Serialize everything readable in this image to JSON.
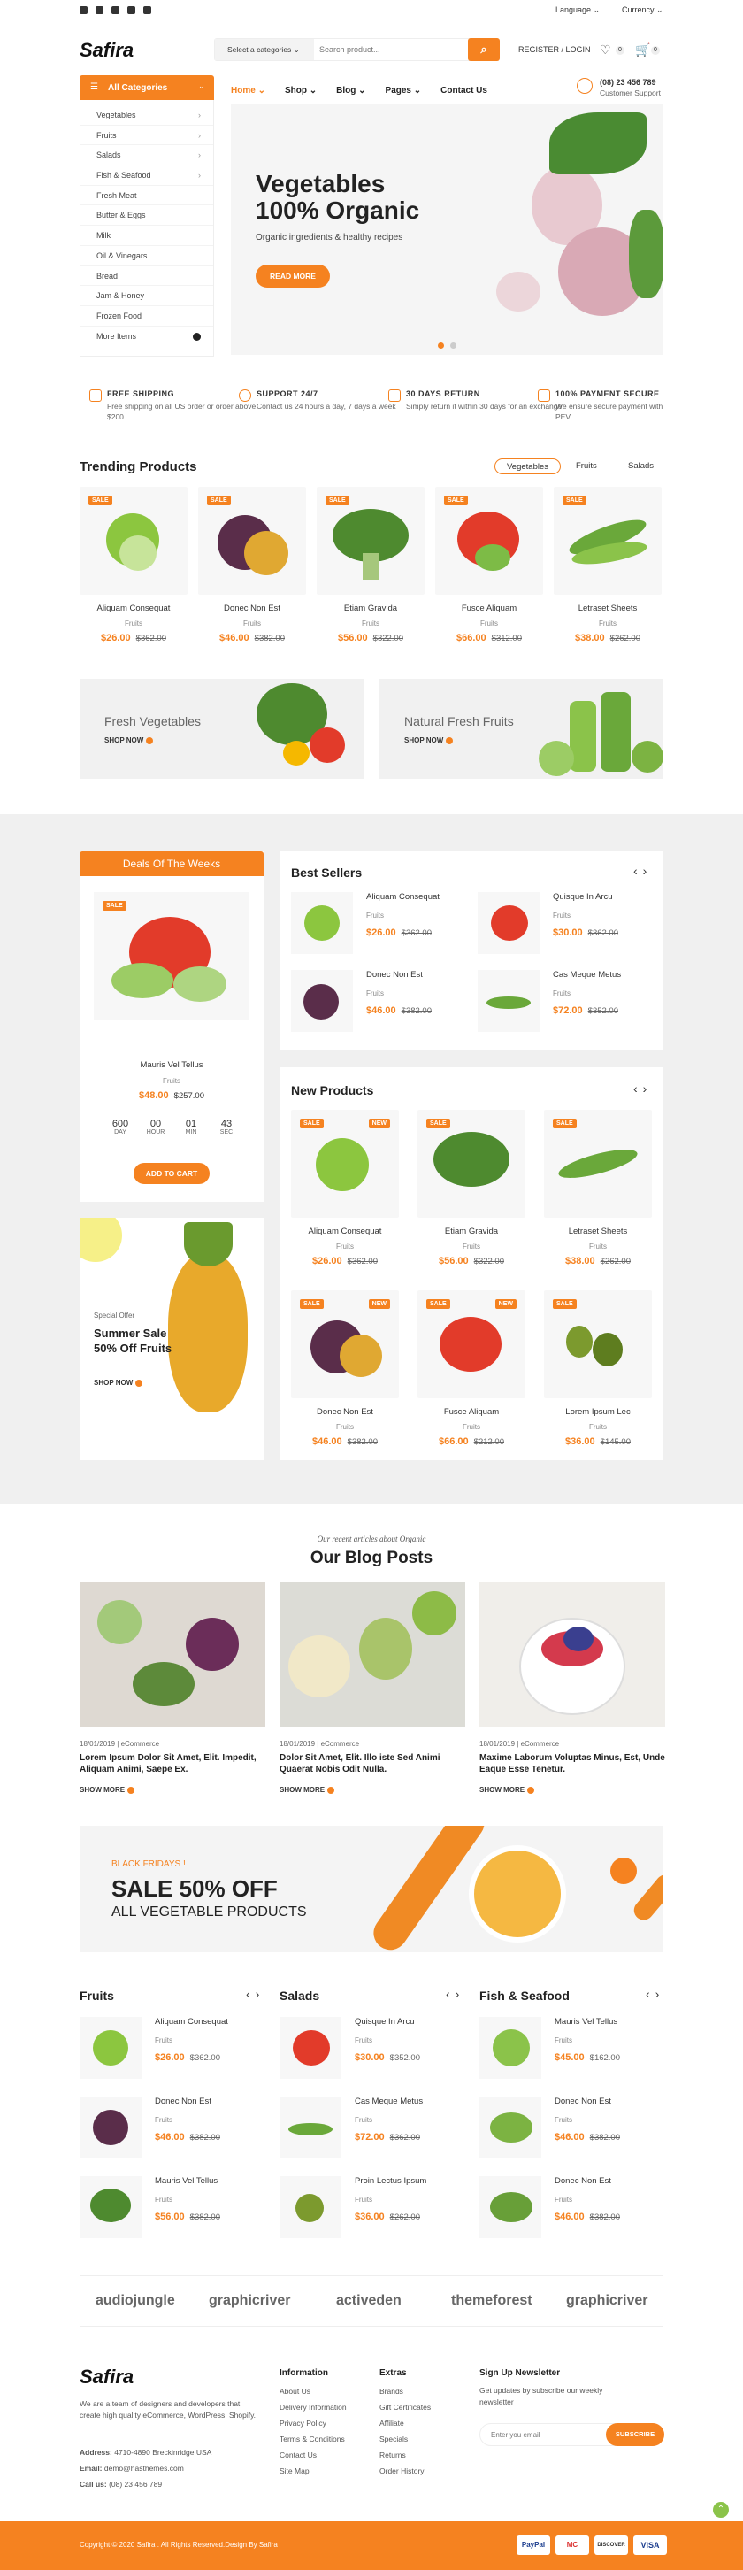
{
  "topbar": {
    "language": "Language",
    "currency": "Currency"
  },
  "header": {
    "logo": "Safira",
    "category_select": "Select a categories",
    "search_placeholder": "Search product...",
    "account": "REGISTER / LOGIN",
    "wishlist_count": "0",
    "cart_count": "0",
    "phone": "(08) 23 456 789",
    "support": "Customer Support"
  },
  "nav": {
    "items": [
      "Home",
      "Shop",
      "Blog",
      "Pages",
      "Contact Us"
    ]
  },
  "sidebar": {
    "title": "All Categories",
    "items": [
      "Vegetables",
      "Fruits",
      "Salads",
      "Fish & Seafood",
      "Fresh Meat",
      "Butter & Eggs",
      "Milk",
      "Oil & Vinegars",
      "Bread",
      "Jam & Honey",
      "Frozen Food",
      "More Items"
    ]
  },
  "hero": {
    "title1": "Vegetables",
    "title2": "100% Organic",
    "subtitle": "Organic ingredients & healthy recipes",
    "cta": "READ MORE"
  },
  "features": [
    {
      "title": "FREE SHIPPING",
      "desc": "Free shipping on all US order or order above $200"
    },
    {
      "title": "SUPPORT 24/7",
      "desc": "Contact us 24 hours a day, 7 days a week"
    },
    {
      "title": "30 DAYS RETURN",
      "desc": "Simply return it within 30 days for an exchange"
    },
    {
      "title": "100% PAYMENT SECURE",
      "desc": "We ensure secure payment with PEV"
    }
  ],
  "trending": {
    "title": "Trending Products",
    "tabs": [
      "Vegetables",
      "Fruits",
      "Salads"
    ],
    "products": [
      {
        "name": "Aliquam Consequat",
        "cat": "Fruits",
        "price": "$26.00",
        "old": "$362.00",
        "badge": "SALE"
      },
      {
        "name": "Donec Non Est",
        "cat": "Fruits",
        "price": "$46.00",
        "old": "$382.00",
        "badge": "SALE"
      },
      {
        "name": "Etiam Gravida",
        "cat": "Fruits",
        "price": "$56.00",
        "old": "$322.00",
        "badge": "SALE"
      },
      {
        "name": "Fusce Aliquam",
        "cat": "Fruits",
        "price": "$66.00",
        "old": "$312.00",
        "badge": "SALE"
      },
      {
        "name": "Letraset Sheets",
        "cat": "Fruits",
        "price": "$38.00",
        "old": "$262.00",
        "badge": "SALE"
      }
    ]
  },
  "banners": [
    {
      "title": "Fresh Vegetables",
      "cta": "SHOP NOW"
    },
    {
      "title": "Natural Fresh Fruits",
      "cta": "SHOP NOW"
    }
  ],
  "deals": {
    "title": "Deals Of The Weeks",
    "badge": "SALE",
    "name": "Mauris Vel Tellus",
    "cat": "Fruits",
    "price": "$48.00",
    "old": "$257.00",
    "countdown": [
      {
        "v": "600",
        "l": "DAY"
      },
      {
        "v": "00",
        "l": "HOUR"
      },
      {
        "v": "01",
        "l": "MIN"
      },
      {
        "v": "43",
        "l": "SEC"
      }
    ],
    "cta": "ADD TO CART"
  },
  "promo": {
    "kicker": "Special Offer",
    "title1": "Summer Sale",
    "title2": "50% Off Fruits",
    "cta": "SHOP NOW"
  },
  "best": {
    "title": "Best Sellers",
    "items": [
      {
        "name": "Aliquam Consequat",
        "cat": "Fruits",
        "price": "$26.00",
        "old": "$362.00"
      },
      {
        "name": "Quisque In Arcu",
        "cat": "Fruits",
        "price": "$30.00",
        "old": "$362.00"
      },
      {
        "name": "Donec Non Est",
        "cat": "Fruits",
        "price": "$46.00",
        "old": "$382.00"
      },
      {
        "name": "Cas Meque Metus",
        "cat": "Fruits",
        "price": "$72.00",
        "old": "$352.00"
      }
    ]
  },
  "newp": {
    "title": "New Products",
    "products": [
      {
        "name": "Aliquam Consequat",
        "cat": "Fruits",
        "price": "$26.00",
        "old": "$362.00",
        "sale": "SALE",
        "new": "NEW"
      },
      {
        "name": "Etiam Gravida",
        "cat": "Fruits",
        "price": "$56.00",
        "old": "$322.00",
        "sale": "SALE",
        "new": ""
      },
      {
        "name": "Letraset Sheets",
        "cat": "Fruits",
        "price": "$38.00",
        "old": "$262.00",
        "sale": "SALE",
        "new": ""
      },
      {
        "name": "Donec Non Est",
        "cat": "Fruits",
        "price": "$46.00",
        "old": "$382.00",
        "sale": "SALE",
        "new": "NEW"
      },
      {
        "name": "Fusce Aliquam",
        "cat": "Fruits",
        "price": "$66.00",
        "old": "$212.00",
        "sale": "SALE",
        "new": "NEW"
      },
      {
        "name": "Lorem Ipsum Lec",
        "cat": "Fruits",
        "price": "$36.00",
        "old": "$145.00",
        "sale": "SALE",
        "new": ""
      }
    ]
  },
  "blog": {
    "kicker": "Our recent articles about Organic",
    "title": "Our Blog Posts",
    "posts": [
      {
        "meta": "18/01/2019 | eCommerce",
        "title": "Lorem Ipsum Dolor Sit Amet, Elit. Impedit, Aliquam Animi, Saepe Ex.",
        "more": "SHOW MORE"
      },
      {
        "meta": "18/01/2019 | eCommerce",
        "title": "Dolor Sit Amet, Elit. Illo iste Sed Animi Quaerat Nobis Odit Nulla.",
        "more": "SHOW MORE"
      },
      {
        "meta": "18/01/2019 | eCommerce",
        "title": "Maxime Laborum Voluptas Minus, Est, Unde Eaque Esse Tenetur.",
        "more": "SHOW MORE"
      }
    ]
  },
  "sale_banner": {
    "kicker": "BLACK FRIDAYS !",
    "title": "SALE 50% OFF",
    "subtitle": "ALL VEGETABLE PRODUCTS"
  },
  "cols": [
    {
      "title": "Fruits",
      "items": [
        {
          "name": "Aliquam Consequat",
          "cat": "Fruits",
          "price": "$26.00",
          "old": "$362.00"
        },
        {
          "name": "Donec Non Est",
          "cat": "Fruits",
          "price": "$46.00",
          "old": "$382.00"
        },
        {
          "name": "Mauris Vel Tellus",
          "cat": "Fruits",
          "price": "$56.00",
          "old": "$382.00"
        }
      ]
    },
    {
      "title": "Salads",
      "items": [
        {
          "name": "Quisque In Arcu",
          "cat": "Fruits",
          "price": "$30.00",
          "old": "$352.00"
        },
        {
          "name": "Cas Meque Metus",
          "cat": "Fruits",
          "price": "$72.00",
          "old": "$362.00"
        },
        {
          "name": "Proin Lectus Ipsum",
          "cat": "Fruits",
          "price": "$36.00",
          "old": "$262.00"
        }
      ]
    },
    {
      "title": "Fish & Seafood",
      "items": [
        {
          "name": "Mauris Vel Tellus",
          "cat": "Fruits",
          "price": "$45.00",
          "old": "$162.00"
        },
        {
          "name": "Donec Non Est",
          "cat": "Fruits",
          "price": "$46.00",
          "old": "$382.00"
        },
        {
          "name": "Donec Non Est",
          "cat": "Fruits",
          "price": "$46.00",
          "old": "$382.00"
        }
      ]
    }
  ],
  "brands": [
    "audiojungle",
    "graphicriver",
    "activeden",
    "themeforest",
    "graphicriver"
  ],
  "footer": {
    "logo": "Safira",
    "about": "We are a team of designers and developers that create high quality eCommerce, WordPress, Shopify.",
    "address_label": "Address:",
    "address": "4710-4890 Breckinridge USA",
    "email_label": "Email:",
    "email": "demo@hasthemes.com",
    "call_label": "Call us:",
    "call": "(08) 23 456 789",
    "info_title": "Information",
    "info": [
      "About Us",
      "Delivery Information",
      "Privacy Policy",
      "Terms & Conditions",
      "Contact Us",
      "Site Map"
    ],
    "extras_title": "Extras",
    "extras": [
      "Brands",
      "Gift Certificates",
      "Affiliate",
      "Specials",
      "Returns",
      "Order History"
    ],
    "news_title": "Sign Up Newsletter",
    "news_desc": "Get updates by subscribe our weekly newsletter",
    "news_placeholder": "Enter you email",
    "news_btn": "SUBSCRIBE",
    "copyright": "Copyright © 2020 Safira . All Rights Reserved.Design By Safira",
    "payments": [
      "PayPal",
      "MC",
      "DISCOVER",
      "VISA"
    ]
  },
  "colors": {
    "accent": "#f58220",
    "panel_bg": "#f0f0f0"
  }
}
